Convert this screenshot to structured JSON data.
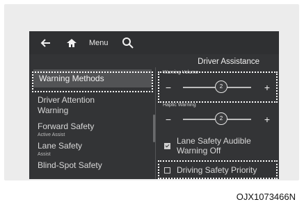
{
  "topbar": {
    "back_icon": "back-arrow-icon",
    "home_icon": "home-icon",
    "menu_label": "Menu",
    "search_icon": "search-icon"
  },
  "panel_title": "Driver Assistance",
  "nav": {
    "items": [
      {
        "label": "Warning Methods",
        "sub": "",
        "selected": true
      },
      {
        "label": "Driver Attention Warning",
        "sub": ""
      },
      {
        "label": "Forward Safety",
        "sub": "Active Assist"
      },
      {
        "label": "Lane Safety",
        "sub": "Assist"
      },
      {
        "label": "Blind-Spot Safety",
        "sub": ""
      }
    ]
  },
  "settings": {
    "warning_volume": {
      "label": "Warning Volume",
      "minus": "−",
      "plus": "+",
      "value": "2"
    },
    "haptic_warning": {
      "label": "Haptic Warning",
      "minus": "−",
      "plus": "+",
      "value": "2"
    },
    "lane_audible": {
      "label": "Lane Safety Audible Warning Off",
      "checked": true
    },
    "driving_priority": {
      "label": "Driving Safety Priority",
      "checked": false
    }
  },
  "caption": "OJX1073466N"
}
